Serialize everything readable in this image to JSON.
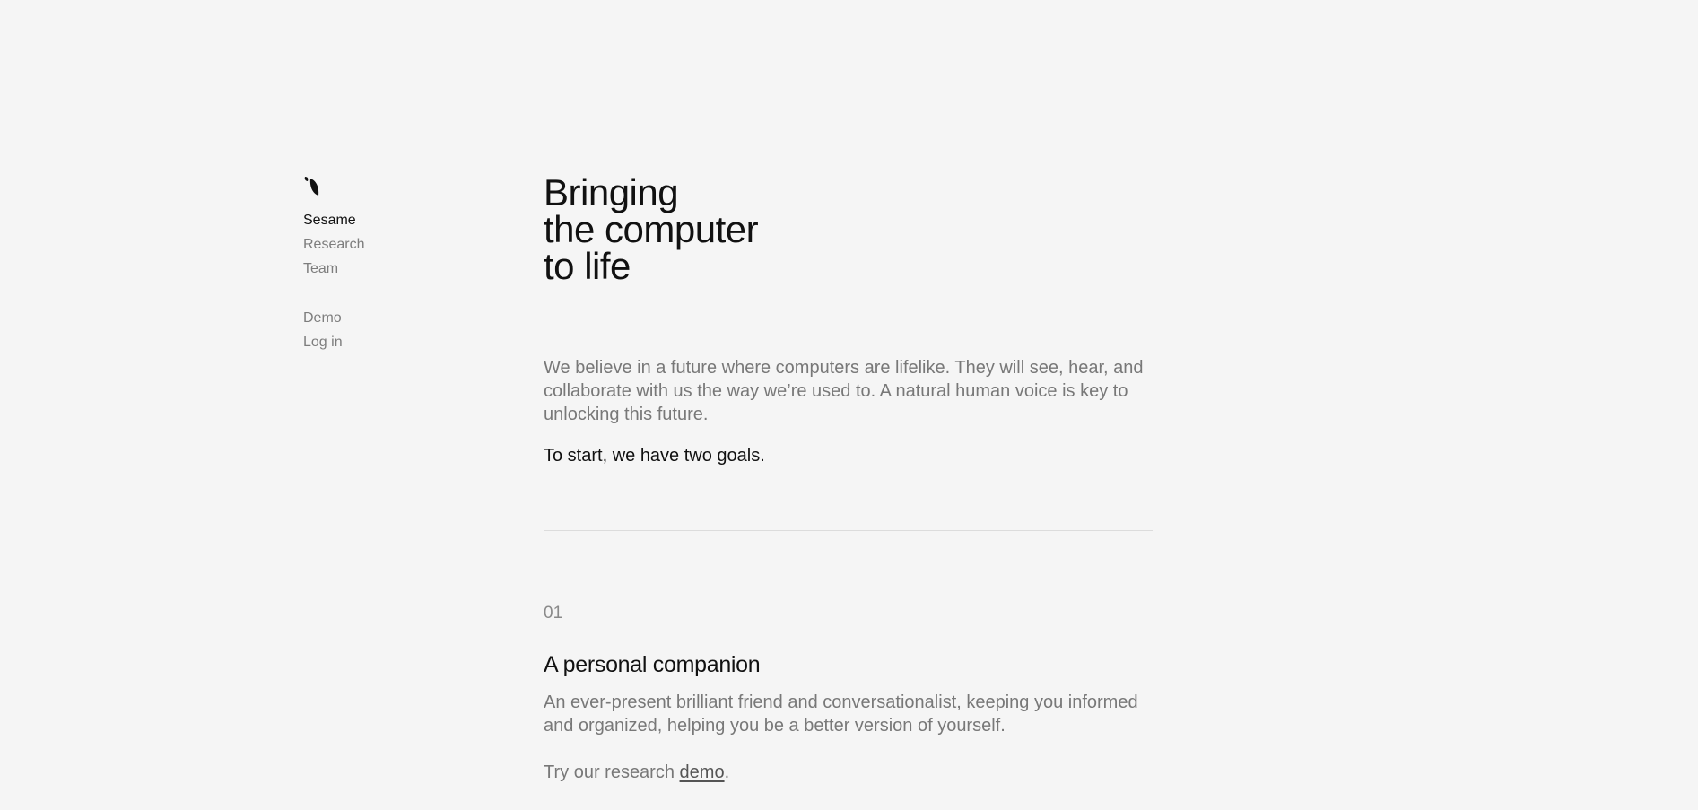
{
  "nav": {
    "brand_label": "Sesame",
    "items": [
      {
        "label": "Research"
      },
      {
        "label": "Team"
      }
    ],
    "secondary": [
      {
        "label": "Demo"
      },
      {
        "label": "Log in"
      }
    ]
  },
  "hero": {
    "title_lines": [
      "Bringing",
      "the computer",
      "to life"
    ]
  },
  "intro": {
    "paragraph": "We believe in a future where computers are lifelike. They will see, hear, and collaborate with us the way we’re used to. A natural human voice is key to unlocking this future.",
    "goals_line": "To start, we have two goals."
  },
  "section": {
    "number": "01",
    "title": "A personal companion",
    "description": "An ever-present brilliant friend and conversationalist, keeping you informed and organized, helping you be a better version of yourself.",
    "cta_prefix": "Try our research ",
    "cta_link": "demo",
    "cta_suffix": "."
  },
  "colors": {
    "background": "#f5f5f5",
    "text_primary": "#111111",
    "text_muted": "#787878"
  },
  "icons": {
    "logo": "sesame-leaf-logo-icon"
  }
}
